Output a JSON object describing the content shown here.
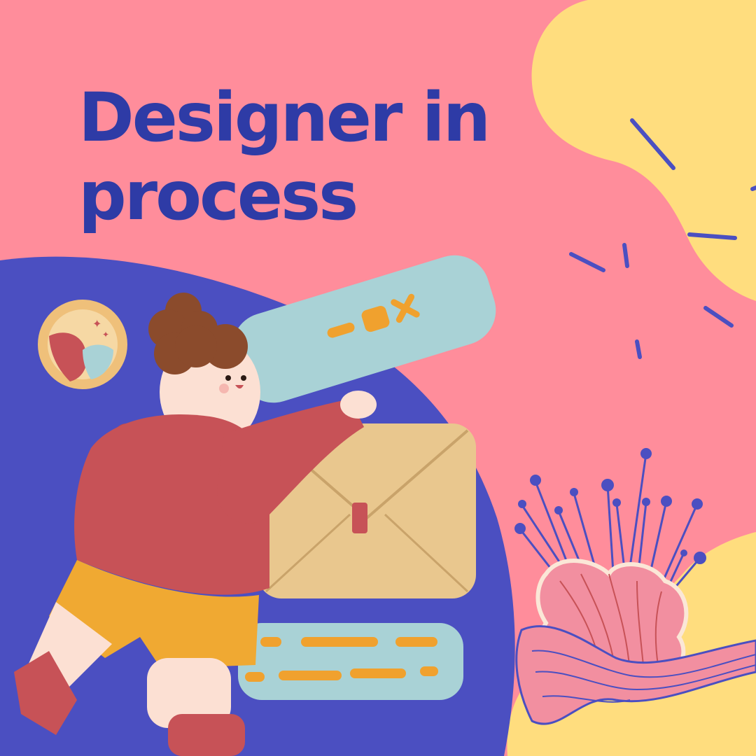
{
  "title": {
    "line1": "Designer in",
    "line2": "process"
  },
  "colors": {
    "background": "#FF8D9B",
    "title_text": "#2E3BA6",
    "blue_blob": "#4B4FC1",
    "yellow_blob": "#FFDD7E",
    "sweater": "#C75257",
    "shorts": "#F0A932",
    "envelope": "#E9C78E",
    "card": "#A9D2D6",
    "accent_orange": "#F0A12E",
    "flower_pink": "#F28FA0"
  },
  "icons": {
    "badge": "landscape-badge-icon",
    "envelope": "envelope-icon",
    "card": "ui-card-icon",
    "flower": "flower-icon"
  }
}
